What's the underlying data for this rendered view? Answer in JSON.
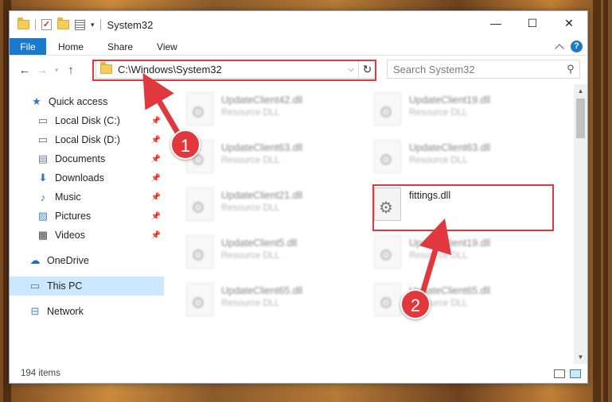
{
  "window": {
    "title": "System32",
    "controls": {
      "minimize": "—",
      "maximize": "☐",
      "close": "✕"
    }
  },
  "ribbon": {
    "tabs": [
      "File",
      "Home",
      "Share",
      "View"
    ]
  },
  "navigation": {
    "address": "C:\\Windows\\System32",
    "search_placeholder": "Search System32"
  },
  "sidebar": {
    "items": [
      {
        "label": "Quick access",
        "icon": "star-icon",
        "pinned": false
      },
      {
        "label": "Local Disk (C:)",
        "icon": "drive-icon",
        "pinned": true
      },
      {
        "label": "Local Disk (D:)",
        "icon": "drive-icon",
        "pinned": true
      },
      {
        "label": "Documents",
        "icon": "documents-icon",
        "pinned": true
      },
      {
        "label": "Downloads",
        "icon": "downloads-icon",
        "pinned": true
      },
      {
        "label": "Music",
        "icon": "music-icon",
        "pinned": true
      },
      {
        "label": "Pictures",
        "icon": "pictures-icon",
        "pinned": true
      },
      {
        "label": "Videos",
        "icon": "videos-icon",
        "pinned": true
      },
      {
        "label": "OneDrive",
        "icon": "onedrive-icon",
        "pinned": false
      },
      {
        "label": "This PC",
        "icon": "computer-icon",
        "pinned": false,
        "selected": true
      },
      {
        "label": "Network",
        "icon": "network-icon",
        "pinned": false
      }
    ]
  },
  "files": [
    {
      "name": "UpdateClient42.dll",
      "type": "Resource DLL"
    },
    {
      "name": "UpdateClient19.dll",
      "type": "Resource DLL"
    },
    {
      "name": "UpdateClient63.dll",
      "type": "Resource DLL"
    },
    {
      "name": "UpdateClient63.dll",
      "type": "Resource DLL"
    },
    {
      "name": "UpdateClient21.dll",
      "type": "Resource DLL"
    },
    {
      "name": "fittings.dll",
      "type": ""
    },
    {
      "name": "UpdateClient5.dll",
      "type": "Resource DLL"
    },
    {
      "name": "UpdateClient19.dll",
      "type": "Resource DLL"
    },
    {
      "name": "UpdateClient65.dll",
      "type": "Resource DLL"
    },
    {
      "name": "UpdateClient65.dll",
      "type": "Resource DLL"
    }
  ],
  "status": {
    "item_count": "194 items"
  },
  "annotations": {
    "step1": "1",
    "step2": "2",
    "color": "#e0383c"
  }
}
